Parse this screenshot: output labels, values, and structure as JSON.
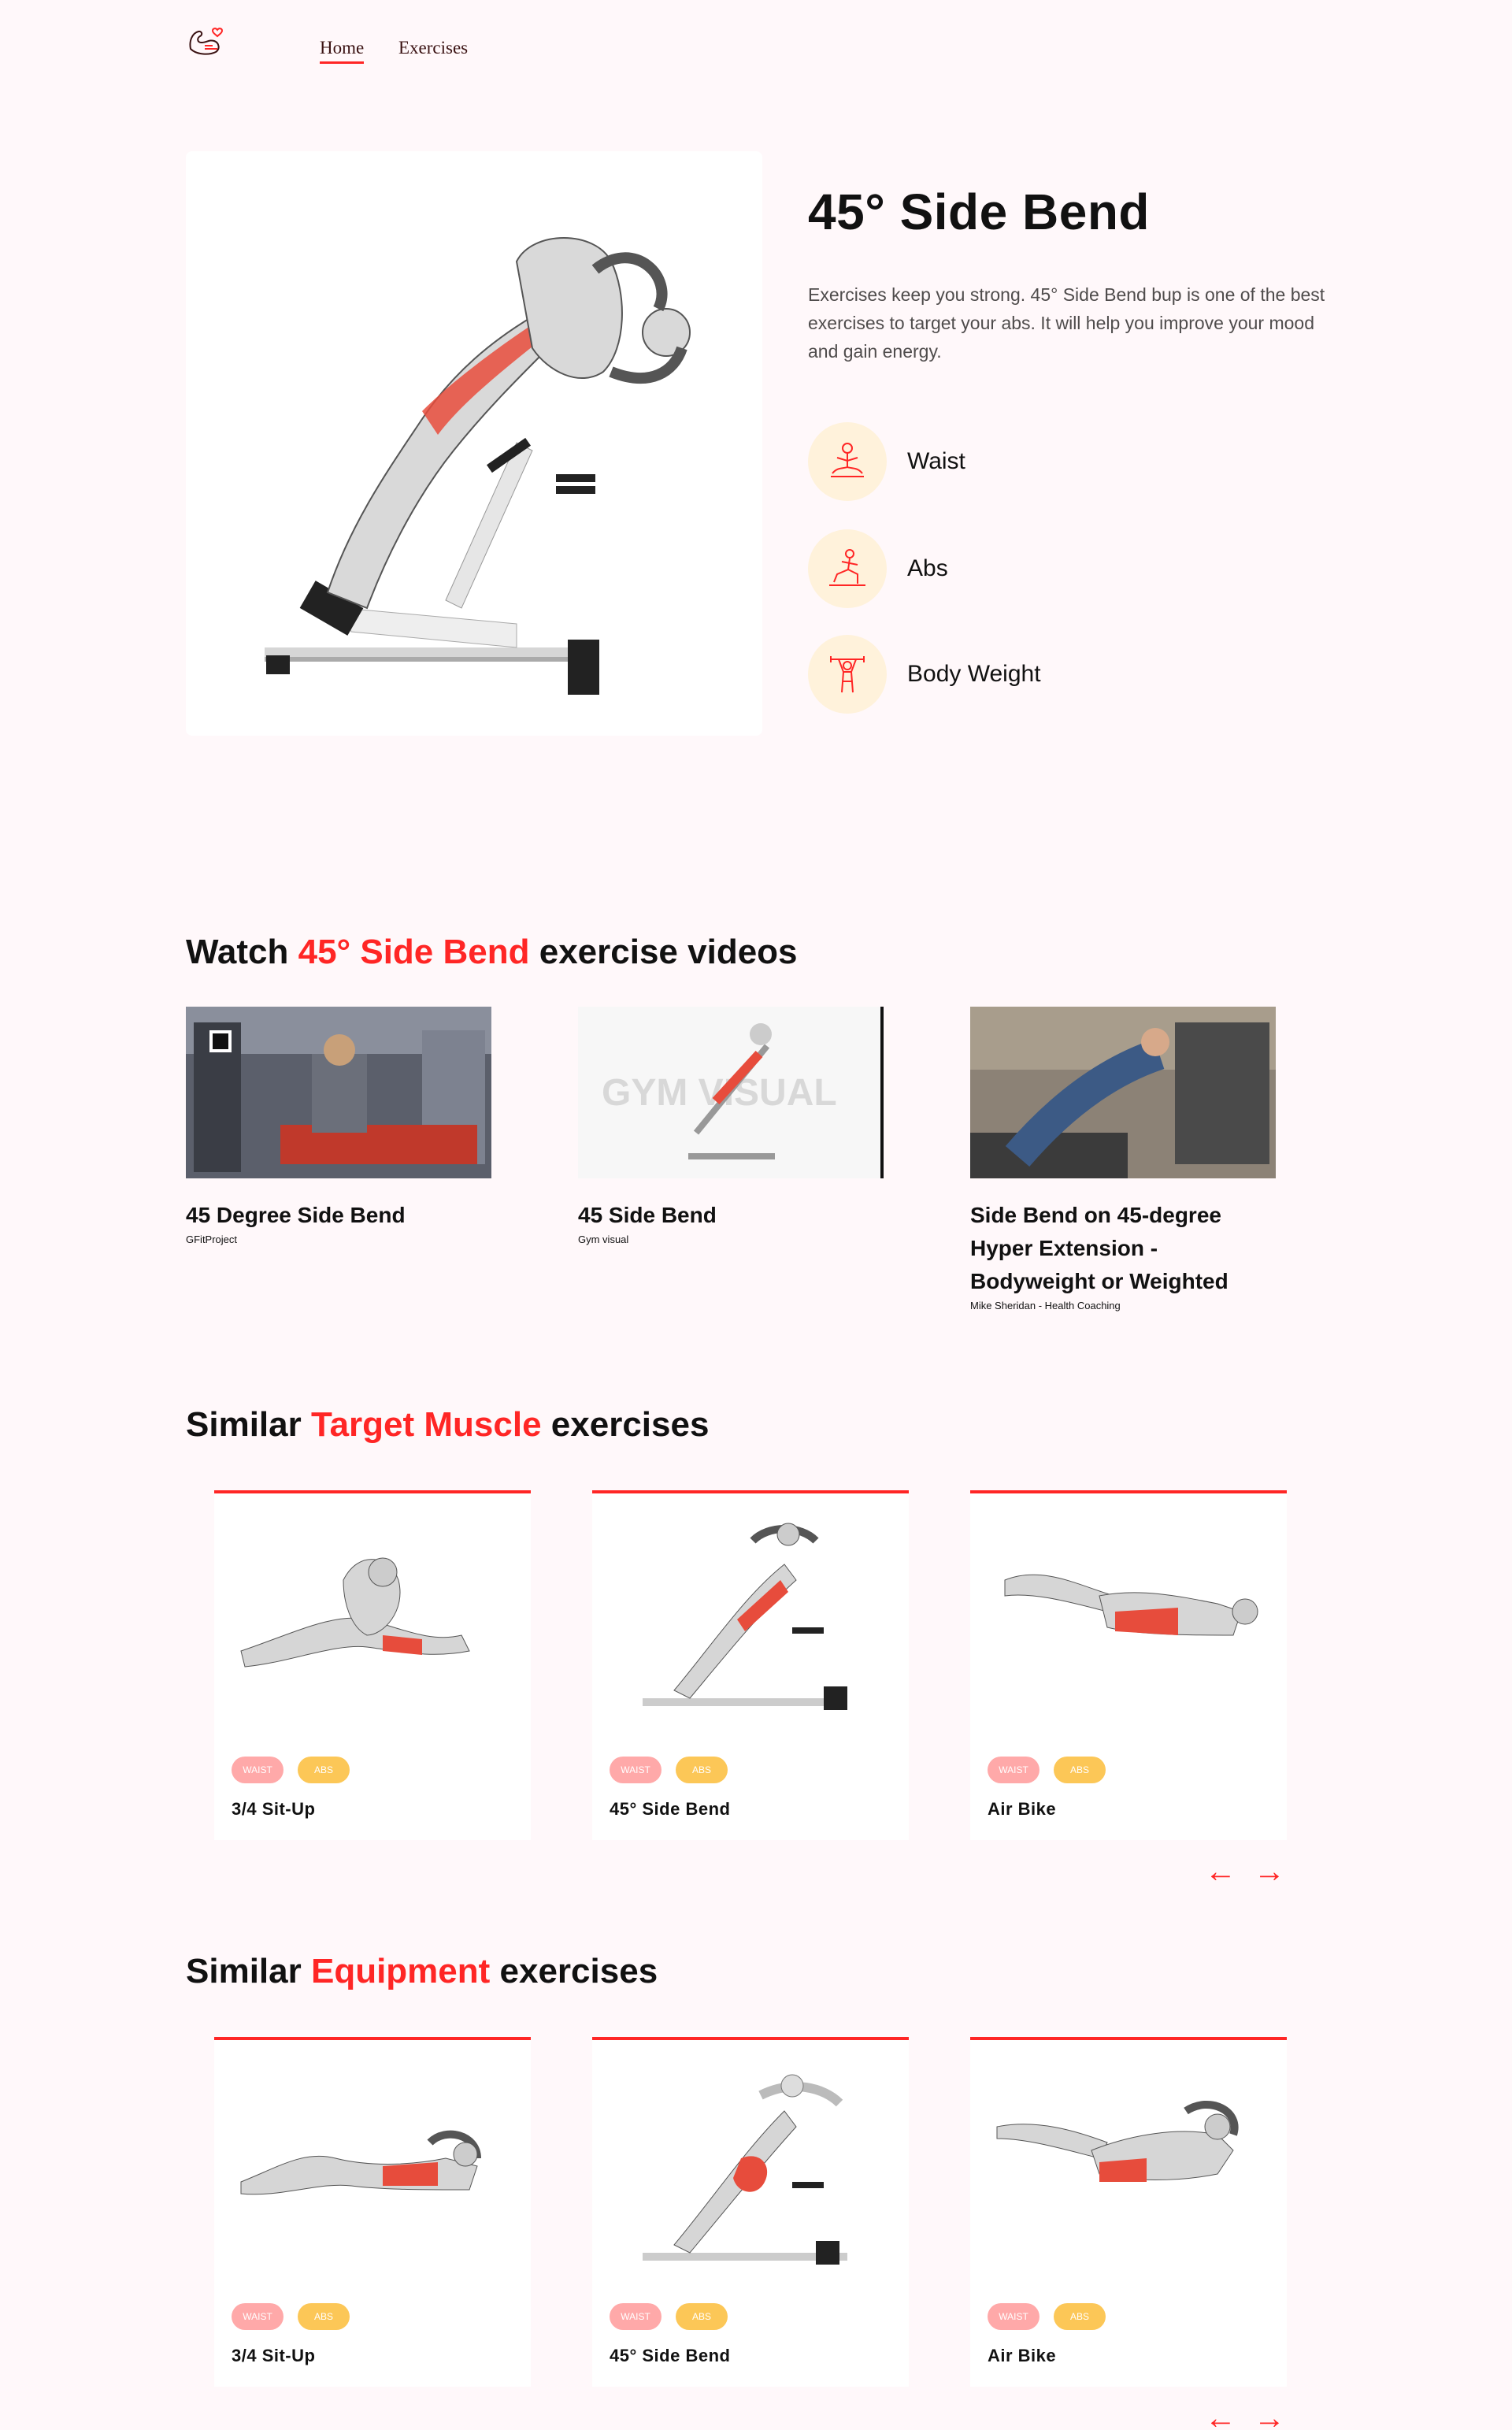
{
  "nav": {
    "home": "Home",
    "exercises": "Exercises",
    "logo_icon": "flexing-arm-logo-icon"
  },
  "hero": {
    "title": "45° Side Bend",
    "desc_lines": [
      "Exercises keep you strong. 45° Side Bend bup is one of the best",
      "exercises to target your abs. It will help you improve your mood and gain energy."
    ],
    "details": [
      {
        "label": "Waist",
        "icon": "meditation-icon"
      },
      {
        "label": "Abs",
        "icon": "lunge-icon"
      },
      {
        "label": "Body Weight",
        "icon": "weightlifter-icon"
      }
    ]
  },
  "videos_section": {
    "pre": "Watch ",
    "accent": "45° Side Bend",
    "post": " exercise videos"
  },
  "videos": [
    {
      "title": "45 Degree Side Bend",
      "channel": "GFitProject"
    },
    {
      "title": "45 Side Bend",
      "channel": "Gym visual"
    },
    {
      "title": "Side Bend on 45-degree Hyper Extension - Bodyweight or Weighted",
      "channel": "Mike Sheridan - Health Coaching"
    }
  ],
  "target_section": {
    "pre": "Similar ",
    "accent": "Target Muscle",
    "post": " exercises"
  },
  "equipment_section": {
    "pre": "Similar ",
    "accent": "Equipment",
    "post": " exercises"
  },
  "target_cards": [
    {
      "name": "3/4 Sit-Up",
      "tags": [
        "waist",
        "abs"
      ]
    },
    {
      "name": "45° Side Bend",
      "tags": [
        "waist",
        "abs"
      ]
    },
    {
      "name": "Air Bike",
      "tags": [
        "waist",
        "abs"
      ]
    }
  ],
  "equipment_cards": [
    {
      "name": "3/4 Sit-Up",
      "tags": [
        "waist",
        "abs"
      ]
    },
    {
      "name": "45° Side Bend",
      "tags": [
        "waist",
        "abs"
      ]
    },
    {
      "name": "Air Bike",
      "tags": [
        "waist",
        "abs"
      ]
    }
  ],
  "arrows": {
    "left": "←",
    "right": "→"
  },
  "colors": {
    "accent": "#ff2625",
    "background": "#fff8fa",
    "detail_circle": "#fff2db",
    "tag_waist": "#ffa9a9",
    "tag_abs": "#fcc757"
  }
}
